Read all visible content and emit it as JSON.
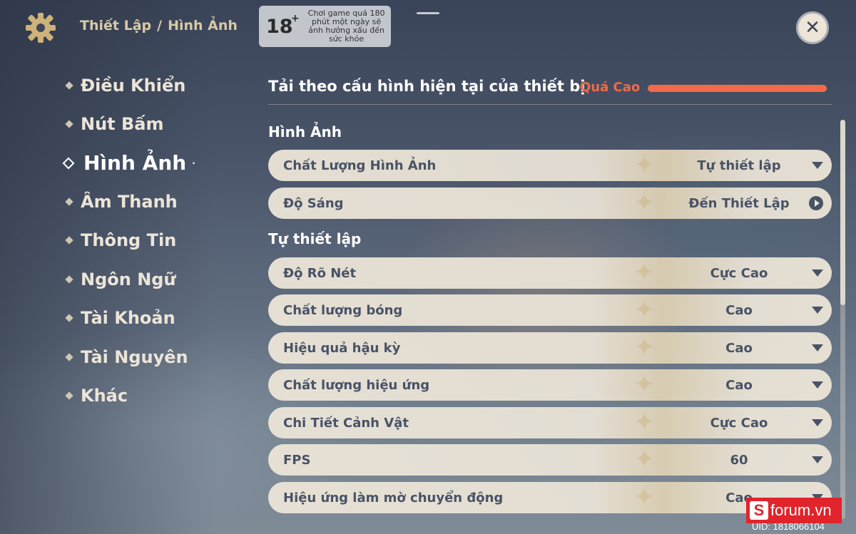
{
  "header": {
    "breadcrumb_parent": "Thiết Lập",
    "breadcrumb_sep": "/",
    "breadcrumb_current": "Hình Ảnh",
    "age_rating": "18",
    "age_plus": "+",
    "age_notice": "Chơi game quá 180 phút một ngày sẽ ảnh hưởng xấu đến sức khỏe",
    "close_icon": "close-icon"
  },
  "sidebar": {
    "items": [
      {
        "label": "Điều Khiển",
        "active": false
      },
      {
        "label": "Nút Bấm",
        "active": false
      },
      {
        "label": "Hình Ảnh",
        "active": true
      },
      {
        "label": "Âm Thanh",
        "active": false
      },
      {
        "label": "Thông Tin",
        "active": false
      },
      {
        "label": "Ngôn Ngữ",
        "active": false
      },
      {
        "label": "Tài Khoản",
        "active": false
      },
      {
        "label": "Tài Nguyên",
        "active": false
      },
      {
        "label": "Khác",
        "active": false
      }
    ]
  },
  "load": {
    "title": "Tải theo cấu hình hiện tại của thiết bị",
    "status": "Quá Cao",
    "status_color": "#f26a47",
    "level": 1.0
  },
  "sections": {
    "graphics_title": "Hình Ảnh",
    "custom_title": "Tự thiết lập"
  },
  "graphics_rows": [
    {
      "label": "Chất Lượng Hình Ảnh",
      "value": "Tự thiết lập",
      "control": "dropdown"
    },
    {
      "label": "Độ Sáng",
      "value": "Đến Thiết Lập",
      "control": "navigate"
    }
  ],
  "custom_rows": [
    {
      "label": "Độ Rõ Nét",
      "value": "Cực Cao"
    },
    {
      "label": "Chất lượng bóng",
      "value": "Cao"
    },
    {
      "label": "Hiệu quả hậu kỳ",
      "value": "Cao"
    },
    {
      "label": "Chất lượng hiệu ứng",
      "value": "Cao"
    },
    {
      "label": "Chi Tiết Cảnh Vật",
      "value": "Cực Cao"
    },
    {
      "label": "FPS",
      "value": "60"
    },
    {
      "label": "Hiệu ứng làm mờ chuyển động",
      "value": "Cao"
    }
  ],
  "watermark": {
    "brand_letter": "S",
    "brand_text": "forum.vn"
  },
  "uid": "UID: 1818066104"
}
